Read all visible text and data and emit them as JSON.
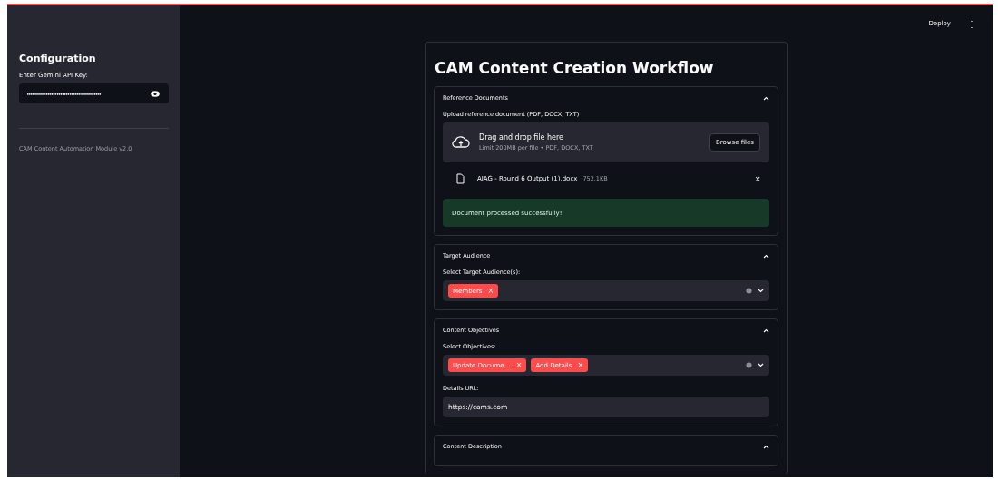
{
  "header": {
    "deploy": "Deploy",
    "menu": "⋮"
  },
  "sidebar": {
    "title": "Configuration",
    "api_key_label": "Enter Gemini API Key:",
    "api_key_value": "••••••••••••••••••••••••••••••••••••••••",
    "footer": "CAM Content Automation Module v2.0"
  },
  "main": {
    "title": "CAM Content Creation Workflow",
    "reference": {
      "title": "Reference Documents",
      "expanded": true,
      "upload_label": "Upload reference document (PDF, DOCX, TXT)",
      "drop_text": "Drag and drop file here",
      "limit_text": "Limit 200MB per file • PDF, DOCX, TXT",
      "browse": "Browse files",
      "file_name": "AIAG - Round 6 Output (1).docx",
      "file_size": "752.1KB",
      "remove_file": "×",
      "success": "Document processed successfully!"
    },
    "audience": {
      "title": "Target Audience",
      "expanded": true,
      "label": "Select Target Audience(s):",
      "tags": [
        {
          "label": "Members",
          "remove": "×"
        }
      ]
    },
    "objectives": {
      "title": "Content Objectives",
      "expanded": true,
      "label": "Select Objectives:",
      "tags": [
        {
          "label": "Update Docume…",
          "remove": "×"
        },
        {
          "label": "Add Details",
          "remove": "×"
        }
      ],
      "url_label": "Details URL:",
      "url_value": "https://cams.com"
    },
    "description": {
      "title": "Content Description",
      "expanded": true
    }
  }
}
